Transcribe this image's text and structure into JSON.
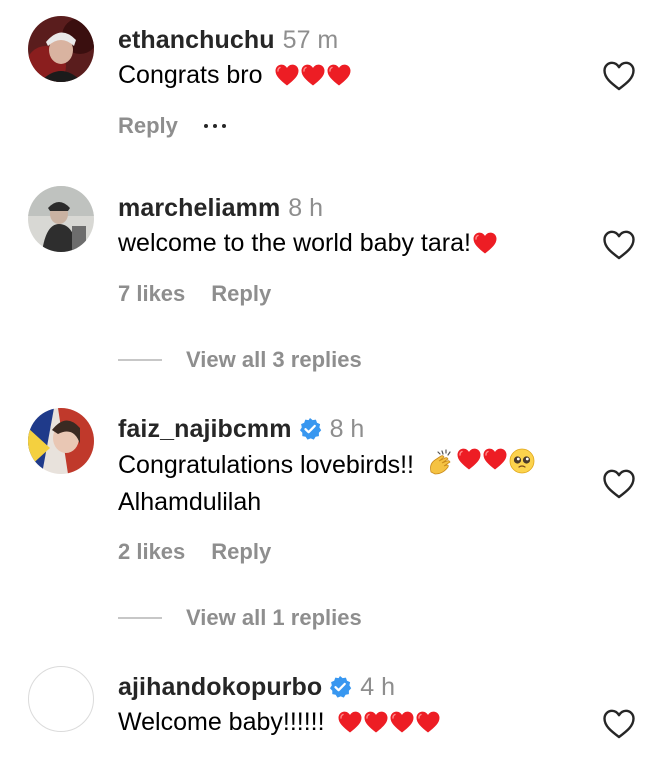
{
  "colors": {
    "username": "#262626",
    "secondary": "#8e8e8e",
    "heart": "#ed1d24",
    "verified": "#3897f0"
  },
  "comments": [
    {
      "username": "ethanchuchu",
      "verified": false,
      "time": "57 m",
      "text": "Congrats bro",
      "text_line2": "",
      "emojis": [
        "red-heart",
        "red-heart",
        "red-heart"
      ],
      "likes": "",
      "reply_label": "Reply",
      "view_replies": ""
    },
    {
      "username": "marcheliamm",
      "verified": false,
      "time": "8 h",
      "text": "welcome to the world baby tara!",
      "text_line2": "",
      "emojis": [
        "red-heart"
      ],
      "likes": "7 likes",
      "reply_label": "Reply",
      "view_replies": "View all 3 replies"
    },
    {
      "username": "faiz_najibcmm",
      "verified": true,
      "time": "8 h",
      "text": "Congratulations lovebirds!!",
      "text_line2": "Alhamdulilah",
      "emojis": [
        "clapping-hands",
        "red-heart",
        "red-heart",
        "pleading-face"
      ],
      "likes": "2 likes",
      "reply_label": "Reply",
      "view_replies": "View all 1 replies"
    },
    {
      "username": "ajihandokopurbo",
      "verified": true,
      "time": "4 h",
      "text": "Welcome baby!!!!!!",
      "text_line2": "",
      "emojis": [
        "red-heart",
        "red-heart",
        "red-heart",
        "red-heart"
      ],
      "likes": "",
      "reply_label": "",
      "view_replies": ""
    }
  ],
  "icons": {
    "like": "heart-outline-icon",
    "verified": "verified-badge-icon",
    "more": "more-horizontal-icon"
  }
}
